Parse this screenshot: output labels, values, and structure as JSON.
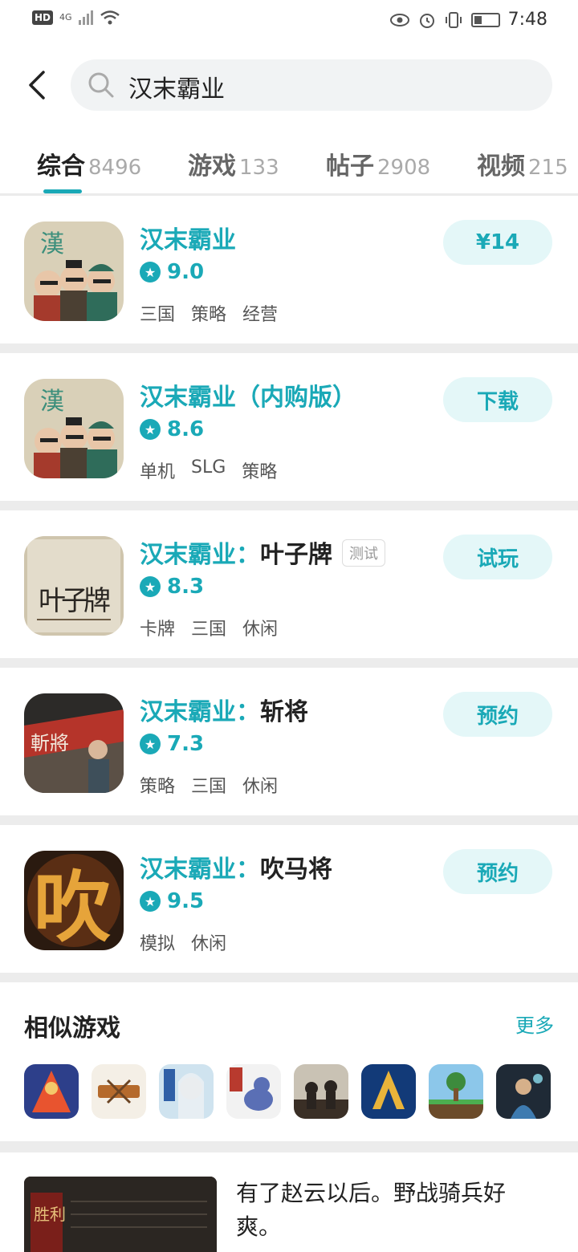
{
  "status_bar": {
    "hd": "HD",
    "network": "4G",
    "time": "7:48"
  },
  "search": {
    "query": "汉末霸业"
  },
  "tabs": [
    {
      "label": "综合",
      "count": "8496"
    },
    {
      "label": "游戏",
      "count": "133"
    },
    {
      "label": "帖子",
      "count": "2908"
    },
    {
      "label": "视频",
      "count": "215"
    }
  ],
  "results": [
    {
      "name": "汉末霸业",
      "subtitle": "",
      "badge": "",
      "rating": "9.0",
      "tags": [
        "三国",
        "策略",
        "经营"
      ],
      "action": "¥14"
    },
    {
      "name": "汉末霸业（内购版）",
      "subtitle": "",
      "badge": "",
      "rating": "8.6",
      "tags": [
        "单机",
        "SLG",
        "策略"
      ],
      "action": "下载"
    },
    {
      "name": "汉末霸业：",
      "subtitle": "叶子牌",
      "badge": "测试",
      "rating": "8.3",
      "tags": [
        "卡牌",
        "三国",
        "休闲"
      ],
      "action": "试玩"
    },
    {
      "name": "汉末霸业：",
      "subtitle": "斩将",
      "badge": "",
      "rating": "7.3",
      "tags": [
        "策略",
        "三国",
        "休闲"
      ],
      "action": "预约"
    },
    {
      "name": "汉末霸业：",
      "subtitle": "吹马将",
      "badge": "",
      "rating": "9.5",
      "tags": [
        "模拟",
        "休闲"
      ],
      "action": "预约"
    }
  ],
  "icon_text": {
    "han": "漢",
    "yezi": "叶子牌",
    "zhanjiang": "斬將",
    "chui": "吹"
  },
  "similar": {
    "title": "相似游戏",
    "more": "更多"
  },
  "post": {
    "text": "有了赵云以后。野战骑兵好爽。",
    "thumb_text": "胜利"
  },
  "colors": {
    "accent": "#1aa9b7",
    "button_bg": "#e4f7f8"
  }
}
